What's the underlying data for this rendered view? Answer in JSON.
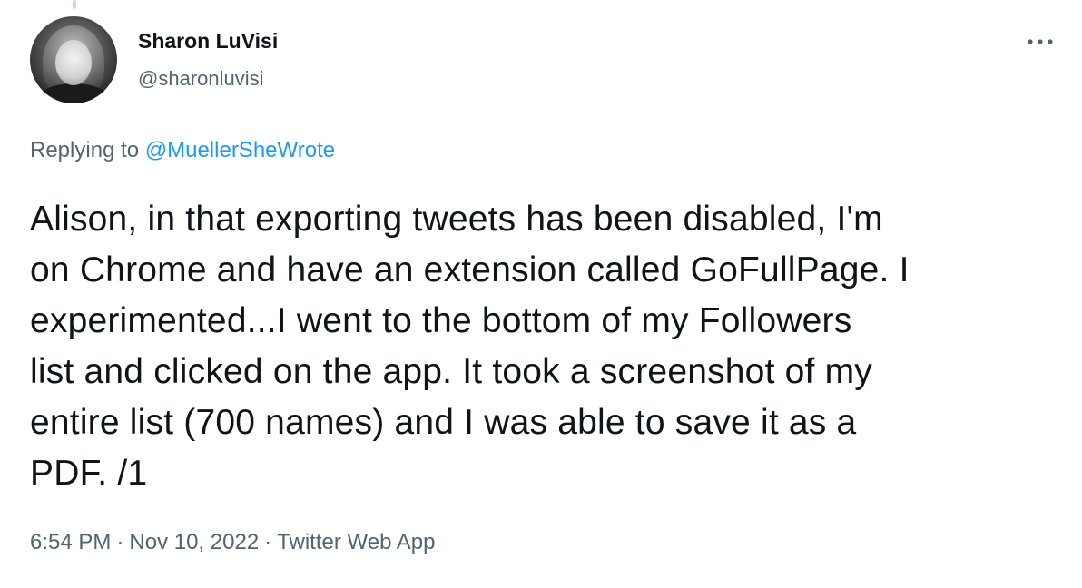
{
  "author": {
    "display_name": "Sharon LuVisi",
    "handle": "@sharonluvisi"
  },
  "reply": {
    "prefix": "Replying to",
    "mention": "@MuellerSheWrote"
  },
  "tweet": {
    "text": "Alison, in that exporting tweets has been disabled, I'm\non Chrome and have an extension called GoFullPage. I\nexperimented...I went to the bottom of my Followers\nlist and clicked on the app. It took a screenshot of my\nentire list (700 names) and I was able to save it as a\nPDF. /1"
  },
  "meta": {
    "time": "6:54 PM",
    "separator": "·",
    "date": "Nov 10, 2022",
    "source": "Twitter Web App"
  },
  "icons": {
    "more": "more-horizontal-icon",
    "avatar": "profile-photo"
  },
  "colors": {
    "link": "#1d9bf0",
    "secondary_text": "#536471",
    "primary_text": "#0f1419"
  }
}
